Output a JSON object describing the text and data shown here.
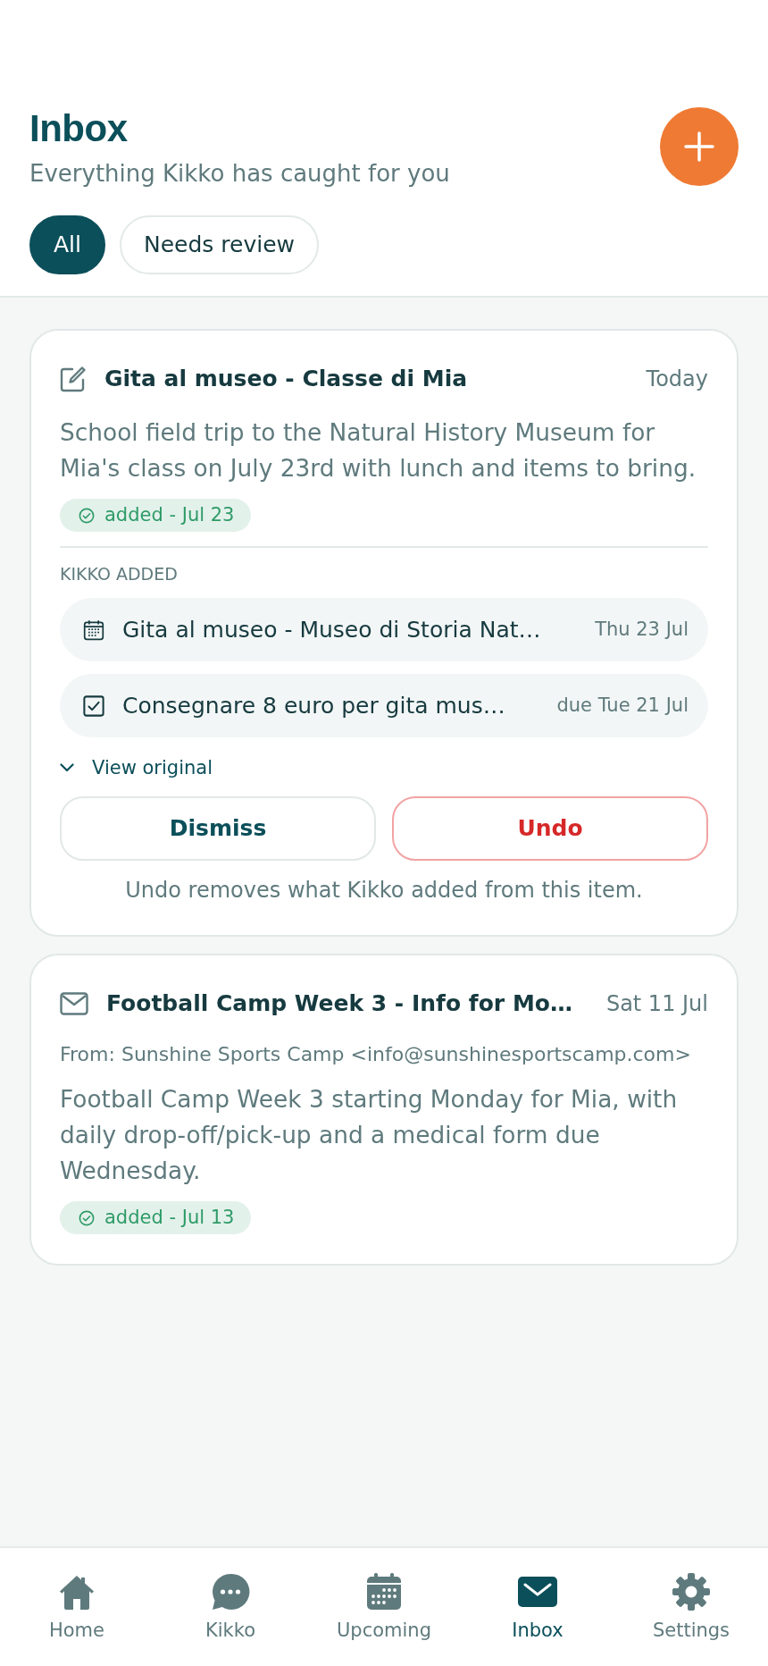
{
  "header": {
    "title": "Inbox",
    "subtitle": "Everything Kikko has caught for you"
  },
  "filters": [
    {
      "label": "All",
      "selected": true
    },
    {
      "label": "Needs review",
      "selected": false
    }
  ],
  "items": [
    {
      "kind": "note",
      "title": "Gita al museo - Classe di Mia",
      "date": "Today",
      "summary": "School field trip to the Natural History Museum for Mia's class on July 23rd with lunch and items to bring.",
      "status": "added - Jul 23",
      "added_heading": "KIKKO ADDED",
      "added": [
        {
          "kind": "event",
          "title": "Gita al museo - Museo di Storia Nat…",
          "date": "Thu 23 Jul"
        },
        {
          "kind": "task",
          "title": "Consegnare 8 euro per gita mus…",
          "date": "due Tue 21 Jul"
        }
      ],
      "view_original": "View original",
      "actions": [
        {
          "kind": "neutral",
          "label": "Dismiss"
        },
        {
          "kind": "danger",
          "label": "Undo"
        }
      ],
      "hint": "Undo removes what Kikko added from this item."
    },
    {
      "kind": "email",
      "title": "Football Camp Week 3 - Info for Mo…",
      "date": "Sat 11 Jul",
      "from": "From: Sunshine Sports Camp <info@sunshinesportscamp.com>",
      "summary": "Football Camp Week 3 starting Monday for Mia, with daily drop-off/pick-up and a medical form due Wednesday.",
      "status": "added - Jul 13"
    }
  ],
  "tab_bar": [
    {
      "label": "Home",
      "selected": false
    },
    {
      "label": "Kikko",
      "selected": false
    },
    {
      "label": "Upcoming",
      "selected": false
    },
    {
      "label": "Inbox",
      "selected": true
    },
    {
      "label": "Settings",
      "selected": false
    }
  ]
}
